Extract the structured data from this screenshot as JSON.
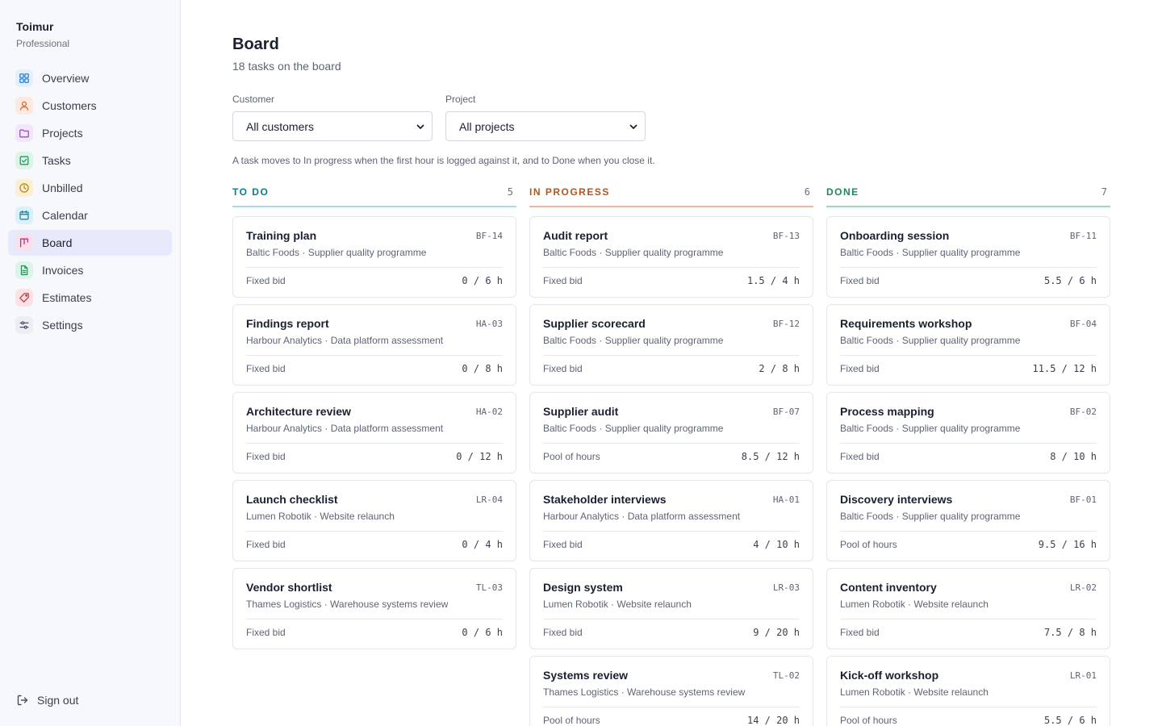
{
  "sidebar": {
    "brand_name": "Toimur",
    "brand_plan": "Professional",
    "items": [
      {
        "label": "Overview",
        "icon": "grid-icon",
        "color": "#2b7fd8",
        "bg": "#e3f0fb"
      },
      {
        "label": "Customers",
        "icon": "person-icon",
        "color": "#d9683a",
        "bg": "#fce9df"
      },
      {
        "label": "Projects",
        "icon": "folder-icon",
        "color": "#9b4fc8",
        "bg": "#f2e6f9"
      },
      {
        "label": "Tasks",
        "icon": "checkbox-icon",
        "color": "#1f9a62",
        "bg": "#dff4e8"
      },
      {
        "label": "Unbilled",
        "icon": "clock-icon",
        "color": "#b88a0e",
        "bg": "#fbf0d3"
      },
      {
        "label": "Calendar",
        "icon": "calendar-icon",
        "color": "#1a88b0",
        "bg": "#dcf0f7"
      },
      {
        "label": "Board",
        "icon": "kanban-icon",
        "color": "#b8357a",
        "bg": "#f8e1ec"
      },
      {
        "label": "Invoices",
        "icon": "document-icon",
        "color": "#1f9a62",
        "bg": "#dff4e8"
      },
      {
        "label": "Estimates",
        "icon": "tag-icon",
        "color": "#cf3b4a",
        "bg": "#fbe2e5"
      },
      {
        "label": "Settings",
        "icon": "sliders-icon",
        "color": "#4a5064",
        "bg": "#eceef3"
      }
    ],
    "active": "Board",
    "signout_label": "Sign out"
  },
  "header": {
    "title": "Board",
    "subtitle": "18 tasks on the board"
  },
  "filters": {
    "customer_label": "Customer",
    "customer_value": "All customers",
    "project_label": "Project",
    "project_value": "All projects"
  },
  "note": "A task moves to In progress when the first hour is logged against it, and to Done when you close it.",
  "columns": [
    {
      "title": "TO DO",
      "count": "5",
      "color": "#0e7c8c",
      "line": "#a8dbe6",
      "cards": [
        {
          "title": "Training plan",
          "id": "BF-14",
          "meta": "Baltic Foods · Supplier quality programme",
          "billing": "Fixed bid",
          "hours": "0 / 6 h"
        },
        {
          "title": "Findings report",
          "id": "HA-03",
          "meta": "Harbour Analytics · Data platform assessment",
          "billing": "Fixed bid",
          "hours": "0 / 8 h"
        },
        {
          "title": "Architecture review",
          "id": "HA-02",
          "meta": "Harbour Analytics · Data platform assessment",
          "billing": "Fixed bid",
          "hours": "0 / 12 h"
        },
        {
          "title": "Launch checklist",
          "id": "LR-04",
          "meta": "Lumen Robotik · Website relaunch",
          "billing": "Fixed bid",
          "hours": "0 / 4 h"
        },
        {
          "title": "Vendor shortlist",
          "id": "TL-03",
          "meta": "Thames Logistics · Warehouse systems review",
          "billing": "Fixed bid",
          "hours": "0 / 6 h"
        }
      ]
    },
    {
      "title": "IN PROGRESS",
      "count": "6",
      "color": "#b4541f",
      "line": "#f2b5a3",
      "cards": [
        {
          "title": "Audit report",
          "id": "BF-13",
          "meta": "Baltic Foods · Supplier quality programme",
          "billing": "Fixed bid",
          "hours": "1.5 / 4 h"
        },
        {
          "title": "Supplier scorecard",
          "id": "BF-12",
          "meta": "Baltic Foods · Supplier quality programme",
          "billing": "Fixed bid",
          "hours": "2 / 8 h"
        },
        {
          "title": "Supplier audit",
          "id": "BF-07",
          "meta": "Baltic Foods · Supplier quality programme",
          "billing": "Pool of hours",
          "hours": "8.5 / 12 h"
        },
        {
          "title": "Stakeholder interviews",
          "id": "HA-01",
          "meta": "Harbour Analytics · Data platform assessment",
          "billing": "Fixed bid",
          "hours": "4 / 10 h"
        },
        {
          "title": "Design system",
          "id": "LR-03",
          "meta": "Lumen Robotik · Website relaunch",
          "billing": "Fixed bid",
          "hours": "9 / 20 h"
        },
        {
          "title": "Systems review",
          "id": "TL-02",
          "meta": "Thames Logistics · Warehouse systems review",
          "billing": "Pool of hours",
          "hours": "14 / 20 h"
        }
      ]
    },
    {
      "title": "DONE",
      "count": "7",
      "color": "#1a8a5a",
      "line": "#9fd9bd",
      "cards": [
        {
          "title": "Onboarding session",
          "id": "BF-11",
          "meta": "Baltic Foods · Supplier quality programme",
          "billing": "Fixed bid",
          "hours": "5.5 / 6 h"
        },
        {
          "title": "Requirements workshop",
          "id": "BF-04",
          "meta": "Baltic Foods · Supplier quality programme",
          "billing": "Fixed bid",
          "hours": "11.5 / 12 h"
        },
        {
          "title": "Process mapping",
          "id": "BF-02",
          "meta": "Baltic Foods · Supplier quality programme",
          "billing": "Fixed bid",
          "hours": "8 / 10 h"
        },
        {
          "title": "Discovery interviews",
          "id": "BF-01",
          "meta": "Baltic Foods · Supplier quality programme",
          "billing": "Pool of hours",
          "hours": "9.5 / 16 h"
        },
        {
          "title": "Content inventory",
          "id": "LR-02",
          "meta": "Lumen Robotik · Website relaunch",
          "billing": "Fixed bid",
          "hours": "7.5 / 8 h"
        },
        {
          "title": "Kick-off workshop",
          "id": "LR-01",
          "meta": "Lumen Robotik · Website relaunch",
          "billing": "Pool of hours",
          "hours": "5.5 / 6 h"
        }
      ]
    }
  ]
}
